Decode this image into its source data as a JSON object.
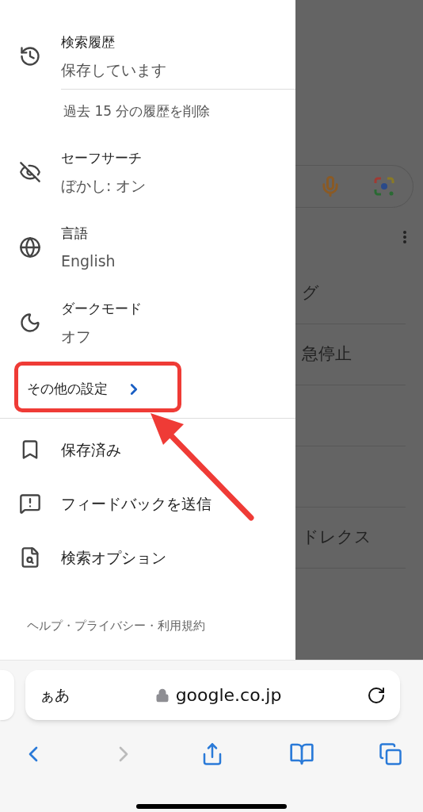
{
  "drawer": {
    "settings": [
      {
        "kind": "history",
        "title": "検索履歴",
        "value": "保存しています",
        "action": "過去 15 分の履歴を削除"
      },
      {
        "kind": "safesearch",
        "title": "セーフサーチ",
        "value": "ぼかし: オン"
      },
      {
        "kind": "language",
        "title": "言語",
        "value": "English"
      },
      {
        "kind": "darkmode",
        "title": "ダークモード",
        "value": "オフ"
      }
    ],
    "more_settings": {
      "label": "その他の設定",
      "highlighted": true
    },
    "links": [
      {
        "kind": "saved",
        "label": "保存済み"
      },
      {
        "kind": "feedback",
        "label": "フィードバックを送信"
      },
      {
        "kind": "search_options",
        "label": "検索オプション"
      }
    ],
    "footer": "ヘルプ・プライバシー・利用規約"
  },
  "background_page": {
    "rows": [
      "グ",
      "急停止",
      "",
      "",
      "ドレクス"
    ]
  },
  "browser": {
    "text_size": "ぁあ",
    "url": "google.co.jp",
    "back_disabled": false,
    "forward_disabled": true
  }
}
